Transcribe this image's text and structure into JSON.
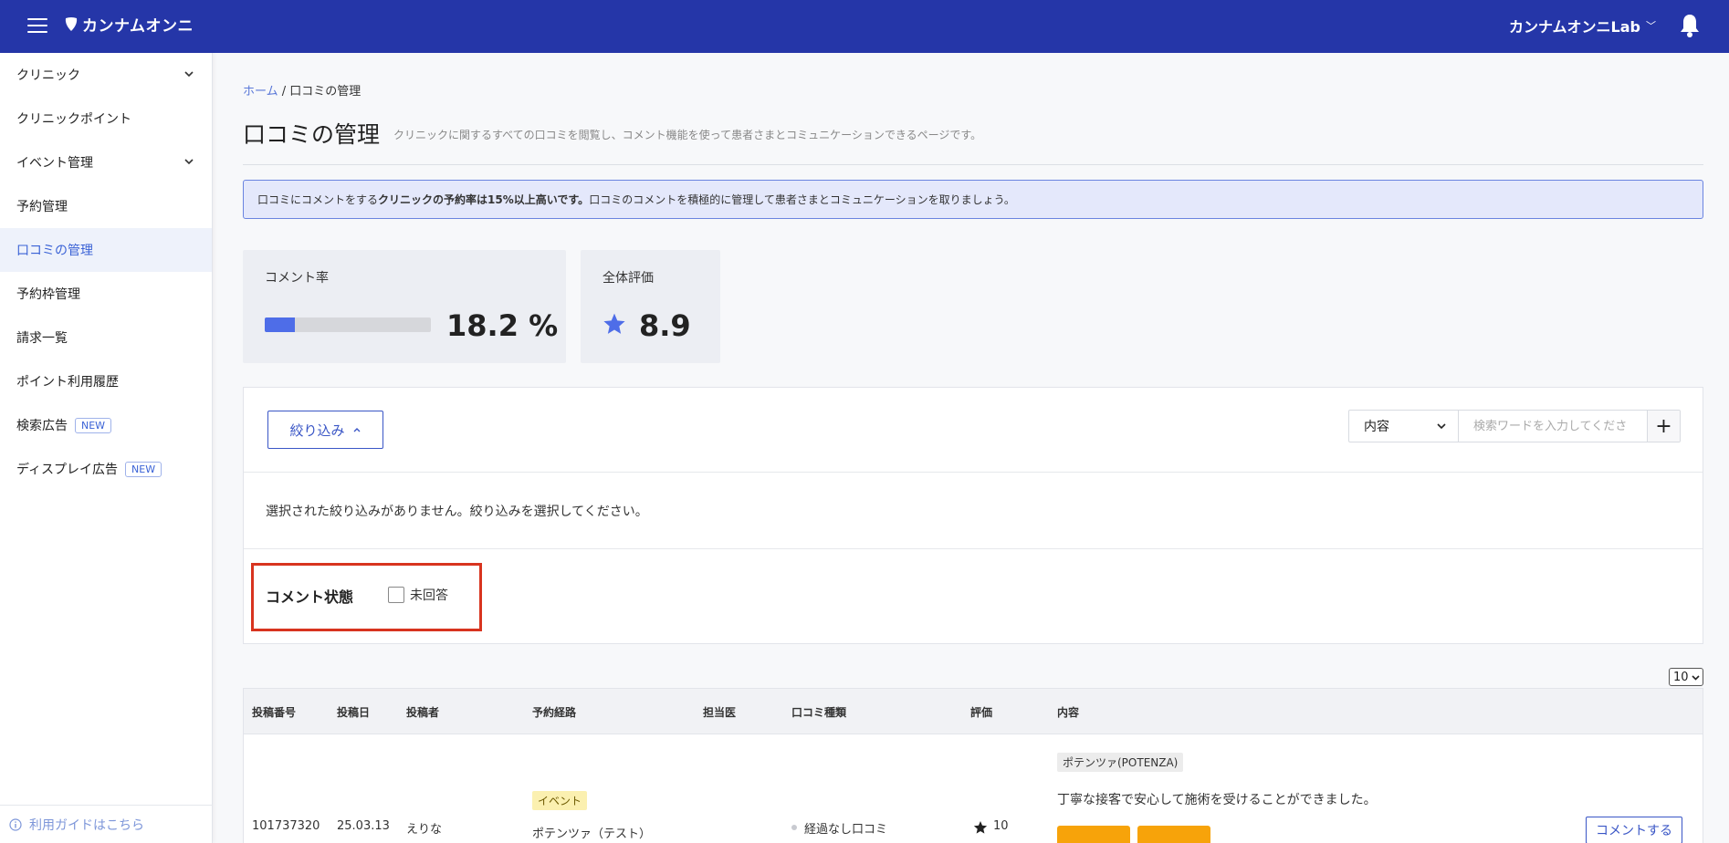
{
  "header": {
    "logo_text": "カンナムオンニ",
    "account_name": "カンナムオンニLab"
  },
  "sidebar": {
    "items": [
      {
        "label": "クリニック"
      },
      {
        "label": "クリニックポイント"
      },
      {
        "label": "イベント管理"
      },
      {
        "label": "予約管理"
      },
      {
        "label": "口コミの管理"
      },
      {
        "label": "予約枠管理"
      },
      {
        "label": "請求一覧"
      },
      {
        "label": "ポイント利用履歴"
      },
      {
        "label": "検索広告",
        "badge": "NEW"
      },
      {
        "label": "ディスプレイ広告",
        "badge": "NEW"
      }
    ],
    "guide_label": "利用ガイドはこちら"
  },
  "breadcrumb": {
    "home": "ホーム",
    "separator": "/",
    "current": "口コミの管理"
  },
  "page": {
    "title": "口コミの管理",
    "description": "クリニックに関するすべての口コミを閲覧し、コメント機能を使って患者さまとコミュニケーションできるページです。"
  },
  "notice": {
    "prefix": "口コミにコメントをする",
    "bold": "クリニックの予約率は15%以上高いです。",
    "suffix": "口コミのコメントを積極的に管理して患者さまとコミュニケーションを取りましょう。"
  },
  "stats": {
    "comment_rate_label": "コメント率",
    "comment_rate_value": "18.2 %",
    "comment_rate_fraction": 0.182,
    "overall_label": "全体評価",
    "overall_value": "8.9"
  },
  "filter": {
    "button_label": "絞り込み",
    "search_select_value": "内容",
    "search_placeholder": "検索ワードを入力してくださ",
    "empty_message": "選択された絞り込みがありません。絞り込みを選択してください。",
    "comment_state_label": "コメント状態",
    "unanswered_label": "未回答"
  },
  "table": {
    "page_size": "10",
    "columns": [
      "投稿番号",
      "投稿日",
      "投稿者",
      "予約経路",
      "担当医",
      "口コミ種類",
      "評価",
      "内容"
    ],
    "rows": [
      {
        "post_no": "101737320",
        "date": "25.03.13",
        "author": "えりな",
        "route_tag": "イベント",
        "route_name": "ポテンツァ（テスト）",
        "review_type": "経過なし口コミ",
        "rating": "10",
        "treatment_tag": "ポテンツァ(POTENZA)",
        "content": "丁寧な接客で安心して施術を受けることができました。",
        "comment_button": "コメントする"
      }
    ]
  },
  "colors": {
    "header_bg": "#2536a8",
    "accent": "#3a56c6",
    "highlight": "#d8341f",
    "progress": "#4e6de8",
    "media_placeholder": "#f7a30a"
  }
}
